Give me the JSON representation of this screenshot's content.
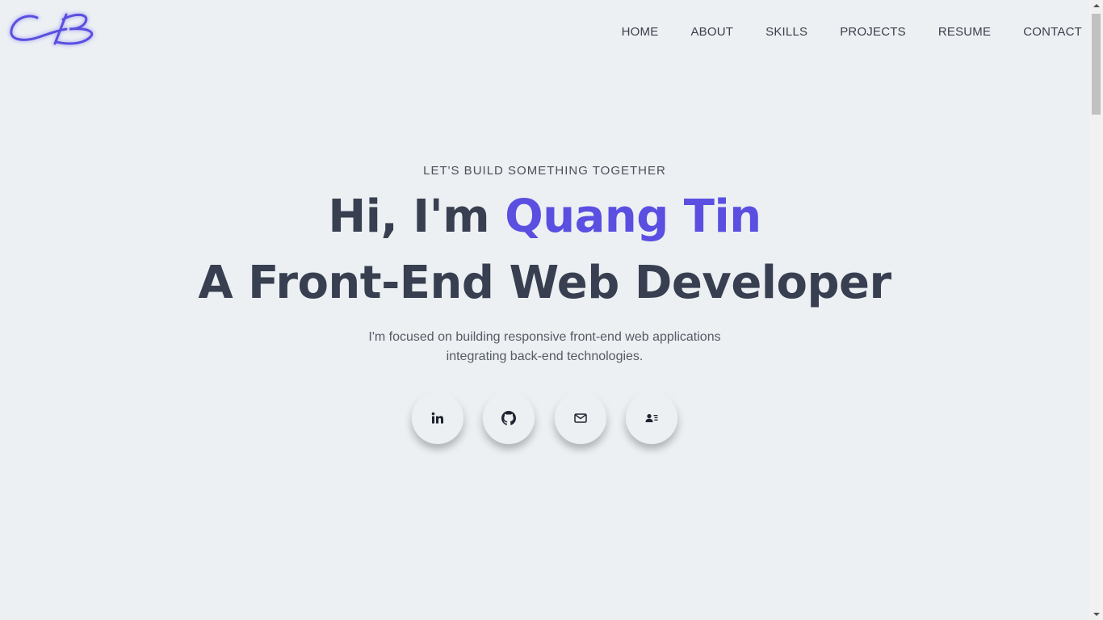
{
  "logo": {
    "text": "CB",
    "color": "#5a4fe0"
  },
  "nav": {
    "items": [
      {
        "label": "HOME"
      },
      {
        "label": "ABOUT"
      },
      {
        "label": "SKILLS"
      },
      {
        "label": "PROJECTS"
      },
      {
        "label": "RESUME"
      },
      {
        "label": "CONTACT"
      }
    ]
  },
  "hero": {
    "tagline": "LET'S BUILD SOMETHING TOGETHER",
    "greeting": "Hi, I'm ",
    "name": "Quang Tin",
    "role": "A Front-End Web Developer",
    "description_line1": "I'm focused on building responsive front-end web applications",
    "description_line2": "integrating back-end technologies."
  },
  "socials": [
    {
      "icon": "linkedin-icon"
    },
    {
      "icon": "github-icon"
    },
    {
      "icon": "mail-icon"
    },
    {
      "icon": "contact-card-icon"
    }
  ],
  "colors": {
    "background": "#ecf0f3",
    "accent": "#5a4fe0",
    "heading": "#373f50"
  }
}
